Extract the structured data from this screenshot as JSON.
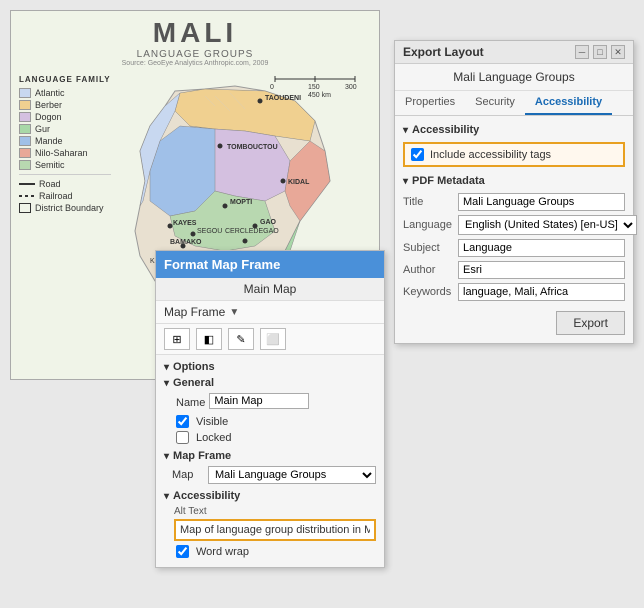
{
  "map": {
    "title_mali": "MALI",
    "title_language": "LANGUAGE GROUPS",
    "title_source": "Source: GeoEye Analytics Anthropic.com, 2009",
    "legend_title": "LANGUAGE FAMILY",
    "legend_items": [
      {
        "label": "Atlantic",
        "color": "#c8d8f0"
      },
      {
        "label": "Berber",
        "color": "#f0d090"
      },
      {
        "label": "Dogon",
        "color": "#d4c0e0"
      },
      {
        "label": "Gur",
        "color": "#a8d8a8"
      },
      {
        "label": "Mande",
        "color": "#a0c0e8"
      },
      {
        "label": "Nilo-Saharan",
        "color": "#e8a898"
      },
      {
        "label": "Semitic",
        "color": "#b8d8b0"
      }
    ],
    "legend_lines": [
      {
        "label": "Road",
        "style": "solid"
      },
      {
        "label": "Railroad",
        "style": "dashed"
      },
      {
        "label": "District Boundary",
        "style": "rect"
      }
    ]
  },
  "format_panel": {
    "title": "Format Map Frame",
    "subtitle": "Main Map",
    "mapframe_label": "Map Frame",
    "icons": [
      "grid-icon",
      "properties-icon",
      "edit-icon",
      "display-icon"
    ],
    "sections": {
      "options_label": "Options",
      "general_label": "General",
      "name_label": "Name",
      "name_value": "Main Map",
      "visible_label": "Visible",
      "locked_label": "Locked",
      "map_frame_label": "Map Frame",
      "map_label": "Map",
      "map_value": "Mali Language Groups",
      "accessibility_label": "Accessibility",
      "alt_text_label": "Alt Text",
      "alt_text_value": "Map of language group distribution in Mali",
      "word_wrap_label": "Word wrap"
    }
  },
  "export_panel": {
    "title": "Export Layout",
    "subtitle": "Mali Language Groups",
    "tabs": [
      {
        "label": "Properties",
        "active": false
      },
      {
        "label": "Security",
        "active": false
      },
      {
        "label": "Accessibility",
        "active": true
      }
    ],
    "titlebar_controls": [
      "minimize",
      "restore",
      "close"
    ],
    "accessibility_section": {
      "header": "Accessibility",
      "checkbox_label": "Include accessibility tags",
      "checked": true
    },
    "pdf_metadata": {
      "header": "PDF Metadata",
      "fields": [
        {
          "label": "Title",
          "value": "Mali Language Groups",
          "type": "text"
        },
        {
          "label": "Language",
          "value": "English (United States) [en-US]",
          "type": "select"
        },
        {
          "label": "Subject",
          "value": "Language",
          "type": "text"
        },
        {
          "label": "Author",
          "value": "Esri",
          "type": "text"
        },
        {
          "label": "Keywords",
          "value": "language, Mali, Africa",
          "type": "text"
        }
      ]
    },
    "export_button": "Export"
  }
}
